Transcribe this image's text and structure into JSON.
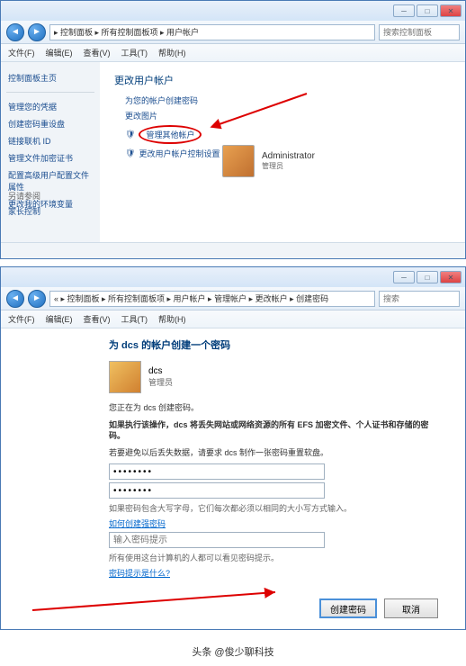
{
  "window1": {
    "breadcrumb": "▸ 控制面板 ▸ 所有控制面板项 ▸ 用户帐户",
    "search_placeholder": "搜索控制面板",
    "menu": [
      "文件(F)",
      "编辑(E)",
      "查看(V)",
      "工具(T)",
      "帮助(H)"
    ],
    "sidebar": {
      "home": "控制面板主页",
      "items": [
        "管理您的凭据",
        "创建密码重设盘",
        "链接联机 ID",
        "管理文件加密证书",
        "配置高级用户配置文件属性",
        "更改我的环境变量"
      ],
      "seealso": "另请参阅",
      "parental": "家长控制"
    },
    "main": {
      "title": "更改用户帐户",
      "links": [
        "为您的帐户创建密码",
        "更改图片"
      ],
      "circled": "管理其他帐户",
      "uac": "更改用户帐户控制设置"
    },
    "admin": {
      "name": "Administrator",
      "role": "管理员"
    }
  },
  "window2": {
    "breadcrumb": "« ▸ 控制面板 ▸ 所有控制面板项 ▸ 用户帐户 ▸ 管理帐户 ▸ 更改帐户 ▸ 创建密码",
    "search_placeholder": "搜索",
    "menu": [
      "文件(F)",
      "编辑(E)",
      "查看(V)",
      "工具(T)",
      "帮助(H)"
    ],
    "form": {
      "title": "为 dcs 的帐户创建一个密码",
      "username": "dcs",
      "role": "管理员",
      "warn1": "您正在为 dcs 创建密码。",
      "warn2": "如果执行该操作，dcs 将丢失网站或网络资源的所有 EFS 加密文件、个人证书和存储的密码。",
      "warn3": "若要避免以后丢失数据，请要求 dcs 制作一张密码重置软盘。",
      "pw_value": "••••••••",
      "hint1": "如果密码包含大写字母，它们每次都必须以相同的大小写方式输入。",
      "link1": "如何创建强密码",
      "hint_placeholder": "输入密码提示",
      "hint2": "所有使用这台计算机的人都可以看见密码提示。",
      "link2": "密码提示是什么?",
      "btn_create": "创建密码",
      "btn_cancel": "取消"
    }
  },
  "watermark": "头条 @俊少聊科技"
}
